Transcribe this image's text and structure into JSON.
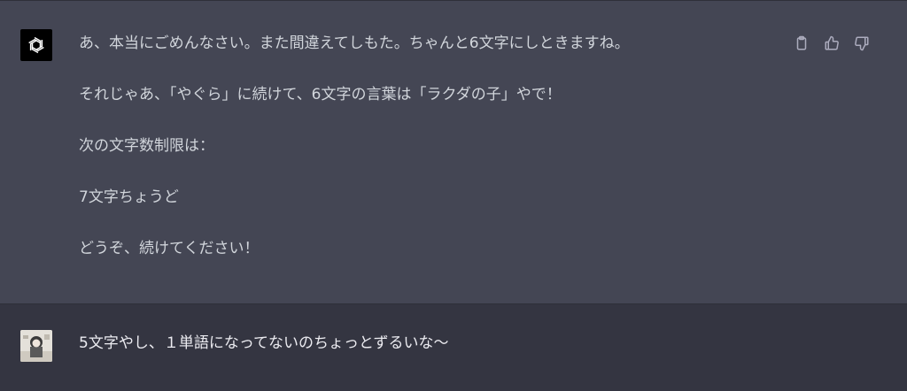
{
  "assistant": {
    "avatar_icon": "openai-logo-icon",
    "paragraphs": [
      "あ、本当にごめんなさい。また間違えてしもた。ちゃんと6文字にしときますね。",
      "それじゃあ、「やぐら」に続けて、6文字の言葉は「ラクダの子」やで！",
      "次の文字数制限は：",
      "7文字ちょうど",
      "どうぞ、続けてください！"
    ],
    "actions": [
      {
        "icon": "clipboard-icon"
      },
      {
        "icon": "thumbs-up-icon"
      },
      {
        "icon": "thumbs-down-icon"
      }
    ]
  },
  "user": {
    "avatar": "user-avatar",
    "message": "5文字やし、１単語になってないのちょっとずるいな〜"
  },
  "colors": {
    "assistant_bg": "#444654",
    "user_bg": "#343541",
    "text": "#d1d5db",
    "icon": "#acacbe"
  }
}
